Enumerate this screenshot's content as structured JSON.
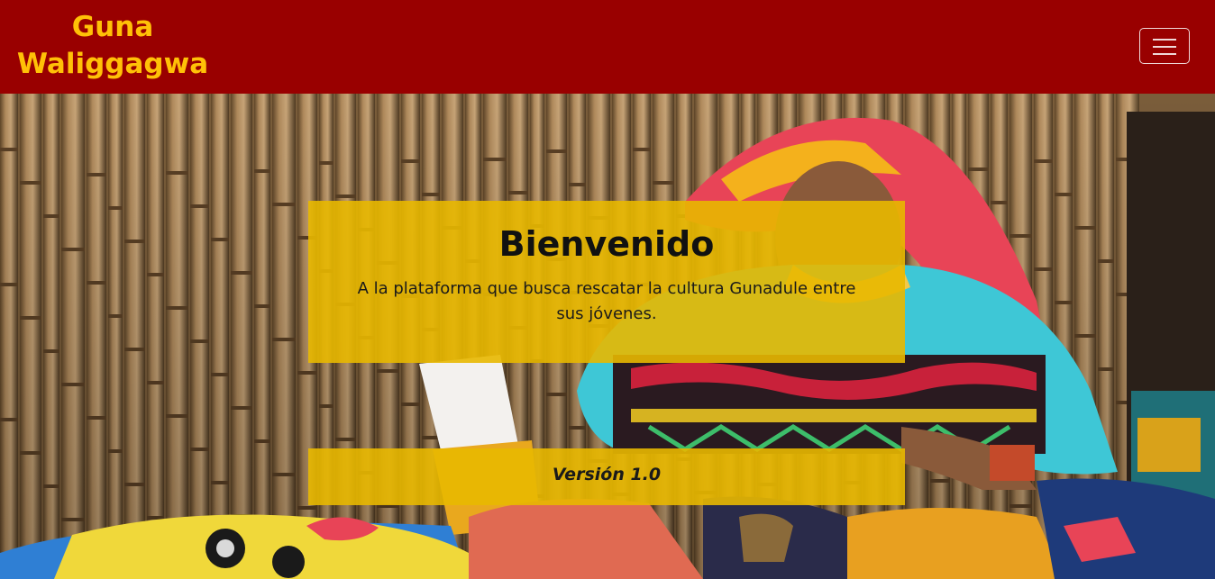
{
  "navbar": {
    "brand_line1": "Guna",
    "brand_line2": "Waliggagwa",
    "toggler_icon": "hamburger-menu-icon",
    "background_color": "#990000",
    "brand_color": "#ffc107"
  },
  "hero": {
    "image": "photo-woman-sewing-mola",
    "welcome": {
      "title": "Bienvenido",
      "text": "A la plataforma que busca rescatar la cultura Gunadule entre sus jóvenes."
    },
    "version_label": "Versión 1.0",
    "card_color": "#e8b800"
  }
}
